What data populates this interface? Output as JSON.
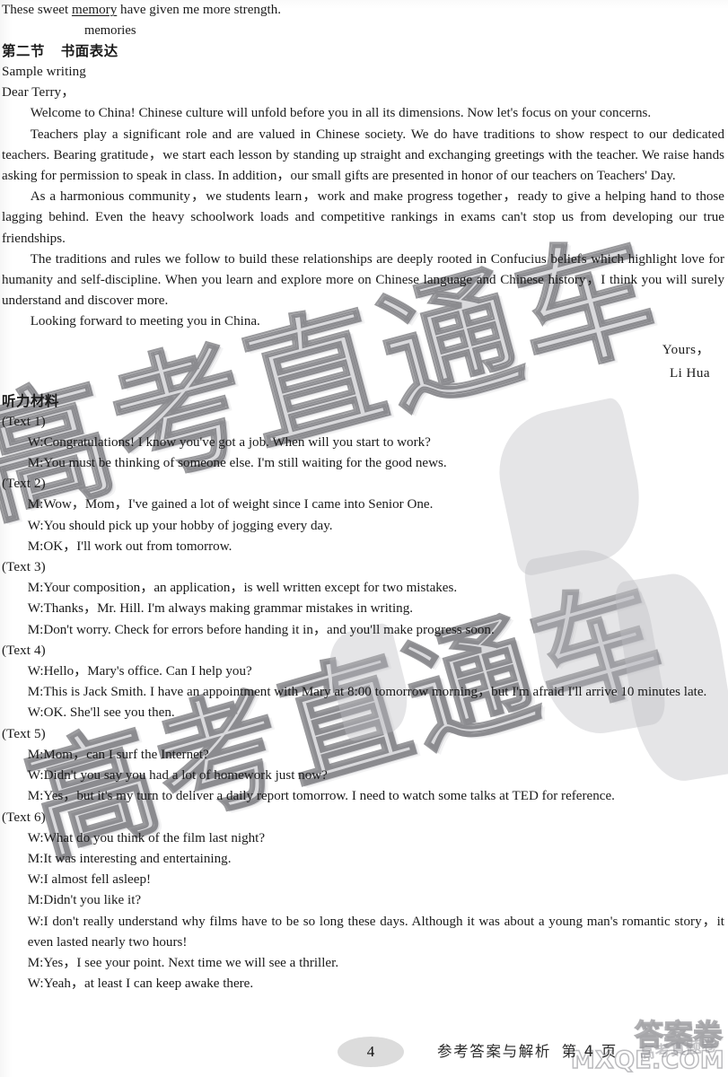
{
  "page": {
    "number": "4",
    "footer_caption_left": "参考答案与解析",
    "footer_caption_right": "第 4 页",
    "watermark_main": "高考直通车",
    "watermark_second": "高考直通车",
    "watermark_footer": "答案卷",
    "watermark_footer_url": "MXQE.COM",
    "watermark_footer_small": "高考真题卷"
  },
  "correction": {
    "before": "These sweet ",
    "struck_word": "memory",
    "after": " have given me more strength.",
    "fix": "memories"
  },
  "section": {
    "heading_part": "第二节",
    "heading_title": "书面表达",
    "sample_label": "Sample writing",
    "salutation": "Dear Terry，"
  },
  "letter": {
    "paragraphs": [
      "Welcome to China! Chinese culture will unfold before you in all its dimensions. Now let's focus on your concerns.",
      "Teachers play a significant role and are valued in Chinese society. We do have traditions to show respect to our dedicated teachers. Bearing gratitude，we start each lesson by standing up straight and exchanging greetings with the teacher. We raise hands asking for permission to speak in class. In addition，our small gifts are presented in honor of our teachers on Teachers' Day.",
      "As a harmonious community，we students learn，work and make progress together，ready to give a helping hand to those lagging behind. Even the heavy schoolwork loads and competitive rankings in exams can't stop us from developing our true friendships.",
      "The traditions and rules we follow to build these relationships are deeply rooted in Confucius beliefs which highlight love for humanity and self-discipline. When you learn and explore more on Chinese language and Chinese history，I think you will surely understand and discover more.",
      "Looking forward to meeting you in China."
    ],
    "sign_off": "Yours，",
    "signature": "Li Hua"
  },
  "listening": {
    "heading": "听力材料",
    "texts": [
      {
        "label": "(Text 1)",
        "lines": [
          {
            "speaker": "W",
            "text": "Congratulations! I know you've got a job. When will you start to work?"
          },
          {
            "speaker": "M",
            "text": "You must be thinking of someone else. I'm still waiting for the good news."
          }
        ]
      },
      {
        "label": "(Text 2)",
        "lines": [
          {
            "speaker": "M",
            "text": "Wow，Mom，I've gained a lot of weight since I came into Senior One."
          },
          {
            "speaker": "W",
            "text": "You should pick up your hobby of jogging every day."
          },
          {
            "speaker": "M",
            "text": "OK，I'll work out from tomorrow."
          }
        ]
      },
      {
        "label": "(Text 3)",
        "lines": [
          {
            "speaker": "M",
            "text": "Your composition，an application，is well written except for two mistakes."
          },
          {
            "speaker": "W",
            "text": "Thanks，Mr. Hill. I'm always making grammar mistakes in writing."
          },
          {
            "speaker": "M",
            "text": "Don't worry. Check for errors before handing it in，and you'll make progress soon."
          }
        ]
      },
      {
        "label": "(Text 4)",
        "lines": [
          {
            "speaker": "W",
            "text": "Hello，Mary's office. Can I help you?"
          },
          {
            "speaker": "M",
            "text": "This is Jack Smith. I have an appointment with Mary at 8:00 tomorrow morning，but I'm afraid I'll arrive 10 minutes late."
          },
          {
            "speaker": "W",
            "text": "OK. She'll see you then."
          }
        ]
      },
      {
        "label": "(Text 5)",
        "lines": [
          {
            "speaker": "M",
            "text": "Mom，can I surf the Internet?"
          },
          {
            "speaker": "W",
            "text": "Didn't you say you had a lot of homework just now?"
          },
          {
            "speaker": "M",
            "text": "Yes，but it's my turn to deliver a daily report tomorrow. I need to watch some talks at TED for reference."
          }
        ]
      },
      {
        "label": "(Text 6)",
        "lines": [
          {
            "speaker": "W",
            "text": "What do you think of the film last night?"
          },
          {
            "speaker": "M",
            "text": "It was interesting and entertaining."
          },
          {
            "speaker": "W",
            "text": "I almost fell asleep!"
          },
          {
            "speaker": "M",
            "text": "Didn't you like it?"
          },
          {
            "speaker": "W",
            "text": "I don't really understand why films have to be so long these days. Although it was about a young man's romantic story，it even lasted nearly two hours!"
          },
          {
            "speaker": "M",
            "text": "Yes，I see your point. Next time we will see a thriller."
          },
          {
            "speaker": "W",
            "text": "Yeah，at least I can keep awake there."
          }
        ]
      }
    ]
  }
}
